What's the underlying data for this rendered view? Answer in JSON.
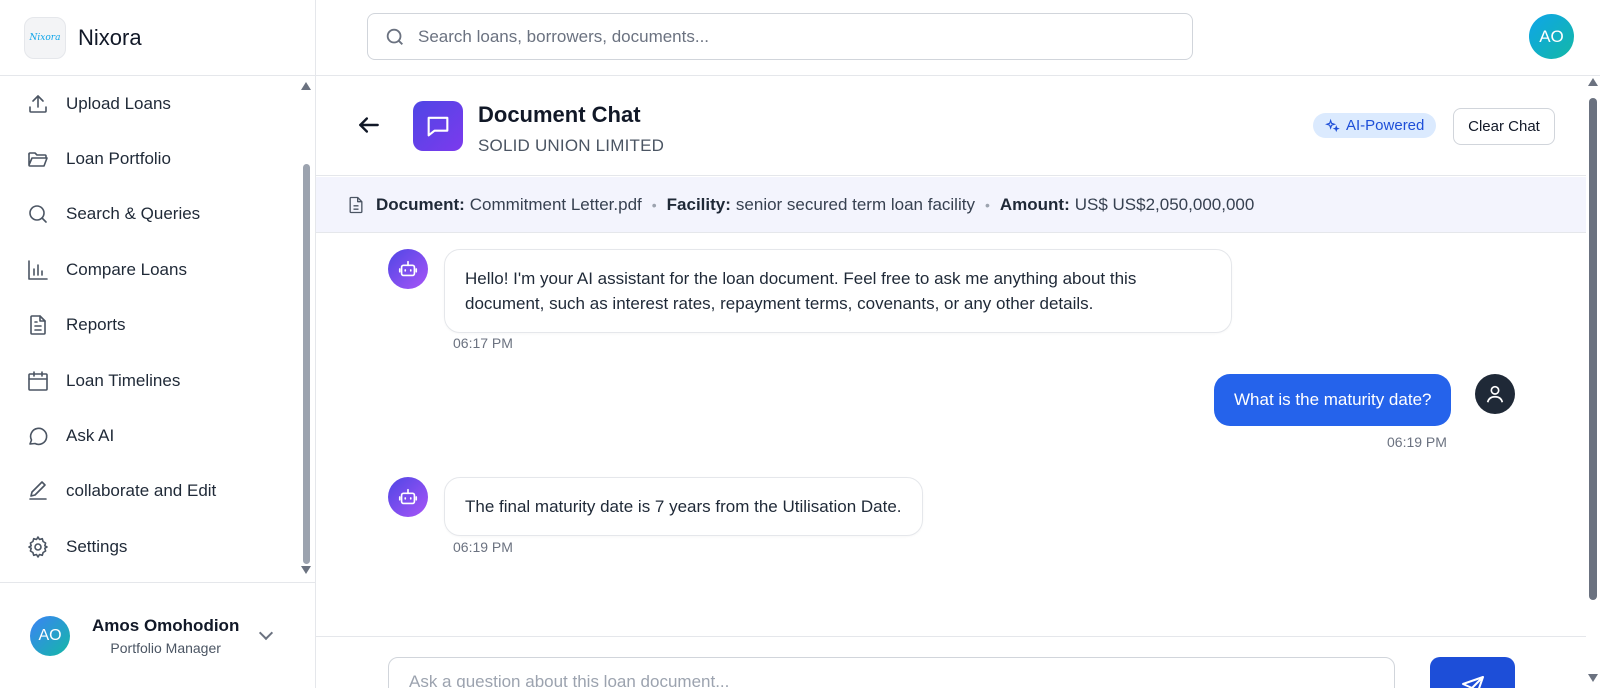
{
  "brand": {
    "logo_text": "Nixora",
    "name": "Nixora"
  },
  "search": {
    "placeholder": "Search loans, borrowers, documents..."
  },
  "top_user": {
    "initials": "AO"
  },
  "sidebar": {
    "items": [
      {
        "label": "Upload Loans",
        "icon": "upload-icon"
      },
      {
        "label": "Loan Portfolio",
        "icon": "folder-icon"
      },
      {
        "label": "Search & Queries",
        "icon": "search-icon"
      },
      {
        "label": "Compare Loans",
        "icon": "bar-chart-icon"
      },
      {
        "label": "Reports",
        "icon": "document-icon"
      },
      {
        "label": "Loan Timelines",
        "icon": "calendar-icon"
      },
      {
        "label": "Ask AI",
        "icon": "message-icon"
      },
      {
        "label": "collaborate and Edit",
        "icon": "pen-icon"
      },
      {
        "label": "Settings",
        "icon": "gear-icon"
      }
    ],
    "user": {
      "initials": "AO",
      "name": "Amos Omohodion",
      "role": "Portfolio Manager"
    }
  },
  "chat": {
    "title": "Document Chat",
    "subtitle": "SOLID UNION LIMITED",
    "badge": "AI-Powered",
    "clear_label": "Clear Chat",
    "doc_info": {
      "document_label": "Document:",
      "document_value": "Commitment Letter.pdf",
      "facility_label": "Facility:",
      "facility_value": "senior secured term loan facility",
      "amount_label": "Amount:",
      "amount_value": "US$ US$2,050,000,000",
      "separator": "•"
    },
    "messages": [
      {
        "role": "assistant",
        "line1": "Hello! I'm your AI assistant for the loan document. Feel free to ask me anything about this",
        "line2": "document, such as interest rates, repayment terms, covenants, or any other details.",
        "time": "06:17 PM"
      },
      {
        "role": "user",
        "text": "What is the maturity date?",
        "time": "06:19 PM"
      },
      {
        "role": "assistant",
        "text": "The final maturity date is 7 years from the Utilisation Date.",
        "time": "06:19 PM"
      }
    ],
    "input_placeholder": "Ask a question about this loan document..."
  },
  "colors": {
    "primary": "#2563eb",
    "accent_gradient_start": "#4f46e5",
    "accent_gradient_end": "#a855f7",
    "badge_bg": "#dbeafe"
  }
}
